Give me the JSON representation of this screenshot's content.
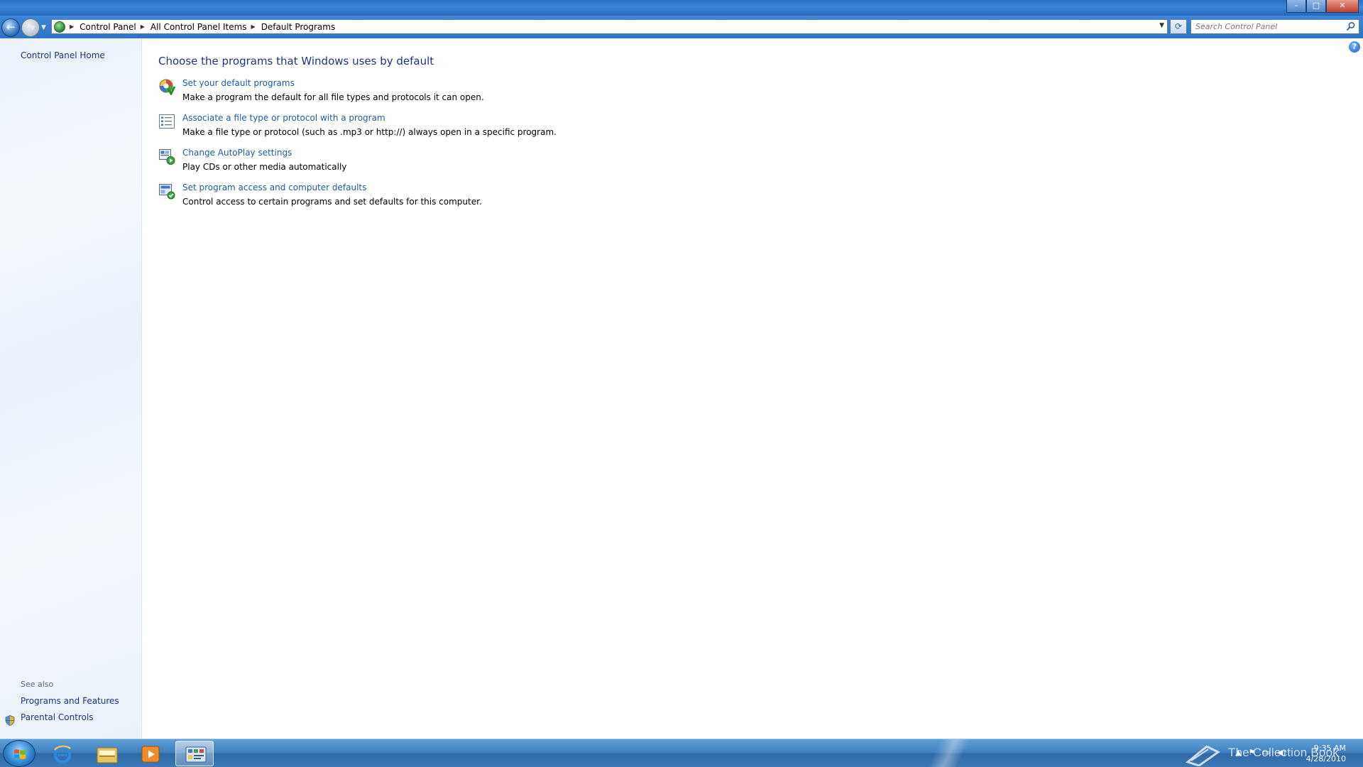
{
  "window": {
    "controls": {
      "minimize": "–",
      "maximize": "□",
      "close": "✕"
    }
  },
  "navigation": {
    "back_glyph": "←",
    "forward_glyph": "→",
    "breadcrumbs": [
      "Control Panel",
      "All Control Panel Items",
      "Default Programs"
    ],
    "refresh_glyph": "⟳",
    "search": {
      "placeholder": "Search Control Panel",
      "value": ""
    }
  },
  "left_pane": {
    "home_link": "Control Panel Home",
    "see_also_title": "See also",
    "see_also_links": [
      "Programs and Features",
      "Parental Controls"
    ]
  },
  "main": {
    "title": "Choose the programs that Windows uses by default",
    "help_glyph": "?",
    "tasks": [
      {
        "icon": "default-programs-icon",
        "link": "Set your default programs",
        "description": "Make a program the default for all file types and protocols it can open."
      },
      {
        "icon": "file-association-icon",
        "link": "Associate a file type or protocol with a program",
        "description": "Make a file type or protocol (such as .mp3 or http://) always open in a specific program."
      },
      {
        "icon": "autoplay-icon",
        "link": "Change AutoPlay settings",
        "description": "Play CDs or other media automatically"
      },
      {
        "icon": "program-access-icon",
        "link": "Set program access and computer defaults",
        "description": "Control access to certain programs and set defaults for this computer."
      }
    ]
  },
  "taskbar": {
    "pinned": [
      "internet-explorer-icon",
      "windows-explorer-icon",
      "media-player-icon",
      "control-panel-icon"
    ],
    "active_item": "control-panel-icon",
    "watermark": "The Collection Book",
    "tray_glyphs": [
      "▲",
      "⚑",
      "▭",
      "◀)"
    ],
    "clock": {
      "time": "9:35 AM",
      "date": "4/28/2010"
    }
  },
  "colors": {
    "link": "#1e5aa8",
    "heading": "#1e3287",
    "titlebar": "#2a6fc2",
    "taskbar": "#3f7fbe"
  }
}
